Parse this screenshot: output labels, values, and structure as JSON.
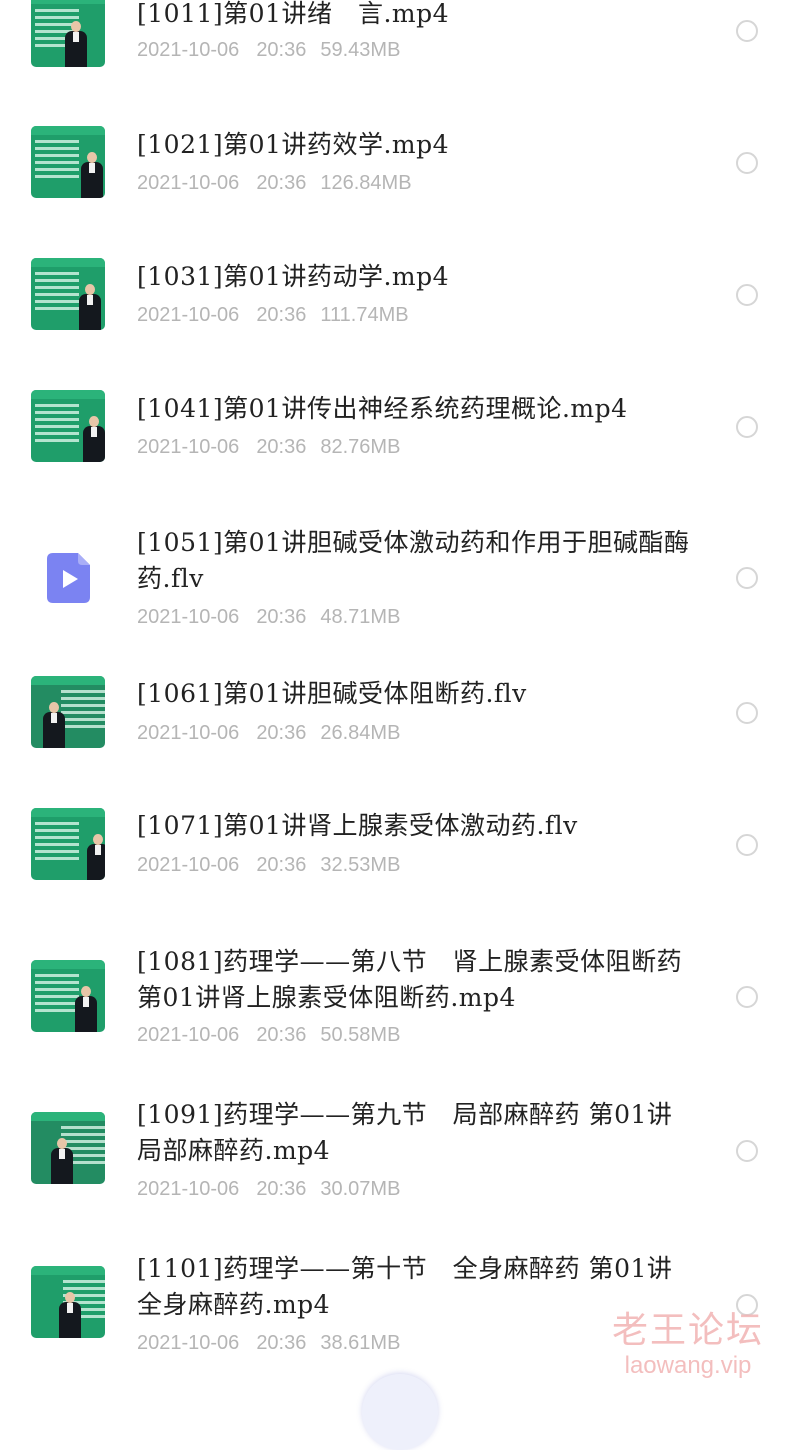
{
  "file_list": {
    "items": [
      {
        "name": "[1011]第01讲绪　言.mp4",
        "date": "2021-10-06",
        "time": "20:36",
        "size": "59.43MB",
        "icon": "video-thumbnail",
        "selected": false
      },
      {
        "name": "[1021]第01讲药效学.mp4",
        "date": "2021-10-06",
        "time": "20:36",
        "size": "126.84MB",
        "icon": "video-thumbnail",
        "selected": false
      },
      {
        "name": "[1031]第01讲药动学.mp4",
        "date": "2021-10-06",
        "time": "20:36",
        "size": "111.74MB",
        "icon": "video-thumbnail",
        "selected": false
      },
      {
        "name": "[1041]第01讲传出神经系统药理概论.mp4",
        "date": "2021-10-06",
        "time": "20:36",
        "size": "82.76MB",
        "icon": "video-thumbnail",
        "selected": false
      },
      {
        "name": "[1051]第01讲胆碱受体激动药和作用于胆碱酯酶药.flv",
        "date": "2021-10-06",
        "time": "20:36",
        "size": "48.71MB",
        "icon": "video-file-icon",
        "selected": false
      },
      {
        "name": "[1061]第01讲胆碱受体阻断药.flv",
        "date": "2021-10-06",
        "time": "20:36",
        "size": "26.84MB",
        "icon": "video-thumbnail",
        "selected": false
      },
      {
        "name": "[1071]第01讲肾上腺素受体激动药.flv",
        "date": "2021-10-06",
        "time": "20:36",
        "size": "32.53MB",
        "icon": "video-thumbnail",
        "selected": false
      },
      {
        "name": "[1081]药理学——第八节　肾上腺素受体阻断药 第01讲肾上腺素受体阻断药.mp4",
        "date": "2021-10-06",
        "time": "20:36",
        "size": "50.58MB",
        "icon": "video-thumbnail",
        "selected": false
      },
      {
        "name": "[1091]药理学——第九节　局部麻醉药 第01讲局部麻醉药.mp4",
        "date": "2021-10-06",
        "time": "20:36",
        "size": "30.07MB",
        "icon": "video-thumbnail",
        "selected": false
      },
      {
        "name": "[1101]药理学——第十节　全身麻醉药 第01讲全身麻醉药.mp4",
        "date": "2021-10-06",
        "time": "20:36",
        "size": "38.61MB",
        "icon": "video-thumbnail",
        "selected": false
      }
    ]
  },
  "watermark": {
    "title": "老王论坛",
    "domain": "laowang.vip"
  },
  "colors": {
    "accent": "#7b83f2",
    "thumbnail_green": "#1f9e6a",
    "meta_gray": "#b5b5b5",
    "name_text": "#222222"
  }
}
